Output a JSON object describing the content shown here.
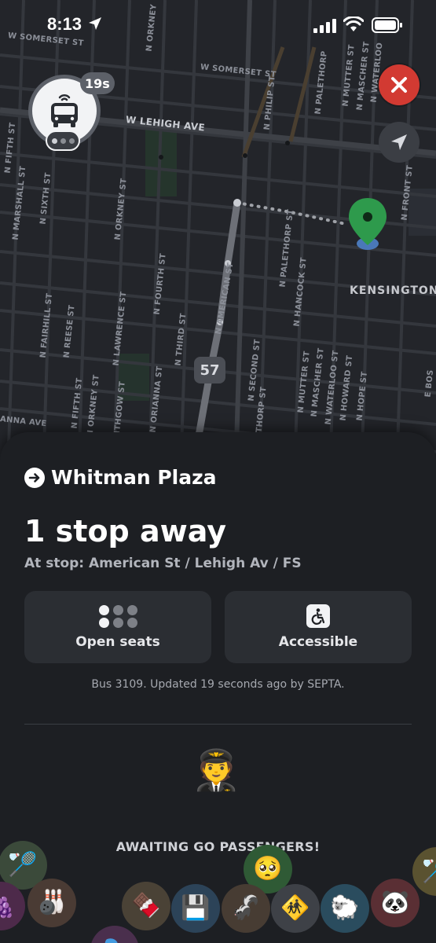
{
  "status_bar": {
    "time": "8:13"
  },
  "map": {
    "streets": {
      "w_somerset_1": "W SOMERSET ST",
      "w_somerset_2": "W SOMERSET ST",
      "w_lehigh": "W LEHIGH AVE",
      "n_philip": "N PHILIP ST",
      "n_palethorp_top": "N PALETHORP",
      "n_mutter_top": "N MUTTER ST",
      "n_mascher_top": "N MASCHER ST",
      "n_waterloo_top": "N WATERLOO",
      "n_orkney_top": "N ORKNEY",
      "n_fifth_top": "N FIFTH ST",
      "n_marshall": "N MARSHALL ST",
      "n_sixth": "N SIXTH ST",
      "n_orkney_mid": "N ORKNEY ST",
      "n_fourth": "N FOURTH ST",
      "n_american": "N AMERICAN ST",
      "n_palethorp_mid": "N PALETHORP ST",
      "n_hancock": "N HANCOCK ST",
      "n_front": "N FRONT ST",
      "n_fairhill": "N FAIRHILL ST",
      "n_reese": "N REESE ST",
      "n_lawrence": "N LAWRENCE ST",
      "n_third": "N THIRD ST",
      "n_second": "N SECOND ST",
      "n_mutter_low": "N MUTTER ST",
      "n_mascher_low": "N MASCHER ST",
      "n_waterloo_low": "N WATERLOO ST",
      "n_howard": "N HOWARD ST",
      "n_hope": "N HOPE ST",
      "n_fifth_low": "N FIFTH ST",
      "n_orkney_low": "N ORKNEY ST",
      "leithgow": "LEITHGOW ST",
      "n_orianna": "N ORIANNA ST",
      "e_bos": "E BOS",
      "indiana": "ANNA AVE",
      "palethorp_low": "THORP ST"
    },
    "district": "KENSINGTON",
    "route_shield": "57"
  },
  "overlay": {
    "timer_badge": "19s",
    "bus_icon": "bus-icon",
    "close_icon": "close-icon",
    "locate_icon": "location-arrow-icon",
    "stop_pin_color": "#2e9a4c",
    "close_color": "#d23a32"
  },
  "sheet": {
    "destination": "Whitman Plaza",
    "stops_away": "1 stop away",
    "at_stop": "At stop: American St / Lehigh Av / FS",
    "cards": {
      "seats_label": "Open seats",
      "access_label": "Accessible"
    },
    "updated_text": "Bus 3109. Updated 19 seconds ago by SEPTA.",
    "pilot_emoji": "🧑‍✈️",
    "awaiting_text": "AWAITING GO PASSENGERS!"
  },
  "bubbles": [
    {
      "emoji": "🏸",
      "bg": "#3b4a3a"
    },
    {
      "emoji": "🥺",
      "bg": "#2f5a35"
    },
    {
      "emoji": "🎳",
      "bg": "#4a3b34"
    },
    {
      "emoji": "🍫",
      "bg": "#4a4236"
    },
    {
      "emoji": "💾",
      "bg": "#2c4358"
    },
    {
      "emoji": "🦨",
      "bg": "#473c33"
    },
    {
      "emoji": "🚸",
      "bg": "#3e4147"
    },
    {
      "emoji": "🐑",
      "bg": "#2a4c5e"
    },
    {
      "emoji": "🐼",
      "bg": "#5a2f34"
    },
    {
      "emoji": "🏸",
      "bg": "#5a5230"
    },
    {
      "emoji": "🍇",
      "bg": "#4d2a4a"
    },
    {
      "emoji": "🎭",
      "bg": "#4a2f4d"
    }
  ]
}
